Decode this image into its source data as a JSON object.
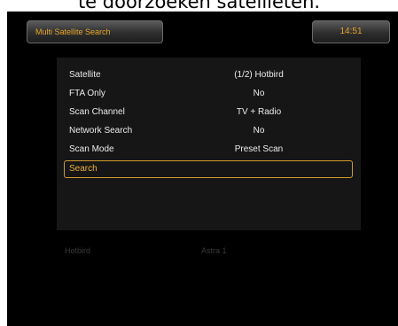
{
  "caption": "te doorzoeken satellieten.",
  "header": {
    "title": "Multi Satellite Search",
    "clock": "14:51"
  },
  "menu": {
    "items": [
      {
        "label": "Satellite",
        "value": "(1/2) Hotbird"
      },
      {
        "label": "FTA Only",
        "value": "No"
      },
      {
        "label": "Scan Channel",
        "value": "TV + Radio"
      },
      {
        "label": "Network Search",
        "value": "No"
      },
      {
        "label": "Scan Mode",
        "value": "Preset Scan"
      },
      {
        "label": "Search",
        "value": ""
      }
    ],
    "selected_index": 5
  },
  "satellites": [
    "Hotbird",
    "Astra 1"
  ],
  "colors": {
    "accent": "#e8a52a",
    "text": "#ececec",
    "background": "#000000",
    "panel": "#161616"
  }
}
